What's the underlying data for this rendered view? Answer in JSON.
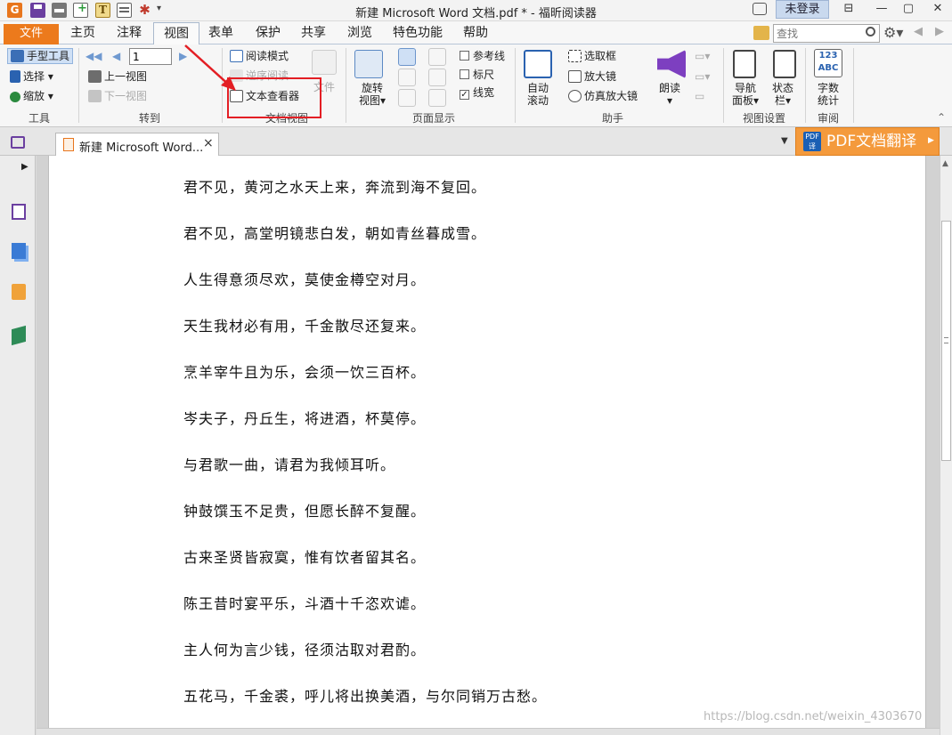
{
  "title_bar": {
    "window_title": "新建 Microsoft Word 文档.pdf * - 福昕阅读器",
    "app_logo_letter": "G",
    "typewriter_letter": "T",
    "login_label": "未登录",
    "min_label": "—",
    "max_label": "▢",
    "close_label": "✕",
    "ribbon_toggle_label": "⊟"
  },
  "menu": {
    "file": "文件",
    "tabs": [
      "主页",
      "注释",
      "视图",
      "表单",
      "保护",
      "共享",
      "浏览",
      "特色功能",
      "帮助"
    ],
    "search_placeholder": "查找"
  },
  "ribbon": {
    "tools": {
      "hand_tool": "手型工具",
      "select": "选择",
      "zoom": "缩放",
      "group_label": "工具"
    },
    "goto": {
      "page_value": "1",
      "prev_view": "上一视图",
      "next_view": "下一视图",
      "group_label": "转到"
    },
    "doc_view": {
      "reading_mode": "阅读模式",
      "reverse_reading": "逆序阅读",
      "text_viewer": "文本查看器",
      "file_big_label": "文件",
      "group_label": "文档视图"
    },
    "page_display": {
      "rotate_view_line1": "旋转",
      "rotate_view_line2": "视图",
      "guides": "参考线",
      "ruler": "标尺",
      "line_weights": "线宽",
      "group_label": "页面显示"
    },
    "assistant": {
      "auto_scroll_line1": "自动",
      "auto_scroll_line2": "滚动",
      "marquee": "选取框",
      "magnifier": "放大镜",
      "loupe": "仿真放大镜",
      "read_aloud": "朗读",
      "group_label": "助手"
    },
    "view_settings": {
      "nav_panel_line1": "导航",
      "nav_panel_line2": "面板",
      "status_bar_line1": "状态",
      "status_bar_line2": "栏",
      "group_label": "视图设置"
    },
    "review": {
      "word_count_icon": "123\nABC",
      "word_count_line1": "字数",
      "word_count_line2": "统计",
      "group_label": "审阅"
    }
  },
  "document_tab": {
    "label": "新建 Microsoft Word...",
    "close": "×"
  },
  "translate_button": {
    "label": "PDF文档翻译",
    "icon_text": "PDF\n译"
  },
  "document": {
    "lines": [
      "君不见，黄河之水天上来，奔流到海不复回。",
      "君不见，高堂明镜悲白发，朝如青丝暮成雪。",
      "人生得意须尽欢，莫使金樽空对月。",
      "天生我材必有用，千金散尽还复来。",
      "烹羊宰牛且为乐，会须一饮三百杯。",
      "岑夫子，丹丘生，将进酒，杯莫停。",
      "与君歌一曲，请君为我倾耳听。",
      "钟鼓馔玉不足贵，但愿长醉不复醒。",
      "古来圣贤皆寂寞，惟有饮者留其名。",
      "陈王昔时宴平乐，斗酒十千恣欢谑。",
      "主人何为言少钱，径须沽取对君酌。",
      "五花马，千金裘，呼儿将出换美酒，与尔同销万古愁。"
    ]
  },
  "watermark": "https://blog.csdn.net/weixin_4303670",
  "colors": {
    "accent_orange": "#ec7a1c",
    "highlight_red": "#e31e24",
    "brand_purple": "#6b3fa0"
  }
}
